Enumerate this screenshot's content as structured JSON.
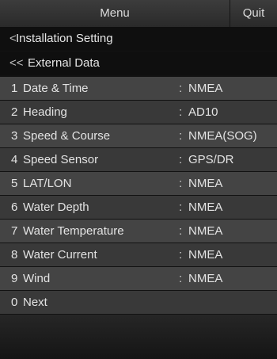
{
  "header": {
    "title": "Menu",
    "quit_label": "Quit"
  },
  "breadcrumb": {
    "level1": {
      "chevron": "<",
      "label": "Installation Setting"
    },
    "level2": {
      "chevron": "<<",
      "label": "External Data"
    }
  },
  "separator": ":",
  "items": [
    {
      "num": "1",
      "label": "Date & Time",
      "value": "NMEA"
    },
    {
      "num": "2",
      "label": "Heading",
      "value": "AD10"
    },
    {
      "num": "3",
      "label": "Speed & Course",
      "value": "NMEA(SOG)"
    },
    {
      "num": "4",
      "label": "Speed Sensor",
      "value": "GPS/DR"
    },
    {
      "num": "5",
      "label": "LAT/LON",
      "value": "NMEA"
    },
    {
      "num": "6",
      "label": "Water Depth",
      "value": "NMEA"
    },
    {
      "num": "7",
      "label": "Water Temperature",
      "value": "NMEA"
    },
    {
      "num": "8",
      "label": "Water Current",
      "value": "NMEA"
    },
    {
      "num": "9",
      "label": "Wind",
      "value": "NMEA"
    },
    {
      "num": "0",
      "label": "Next"
    }
  ]
}
